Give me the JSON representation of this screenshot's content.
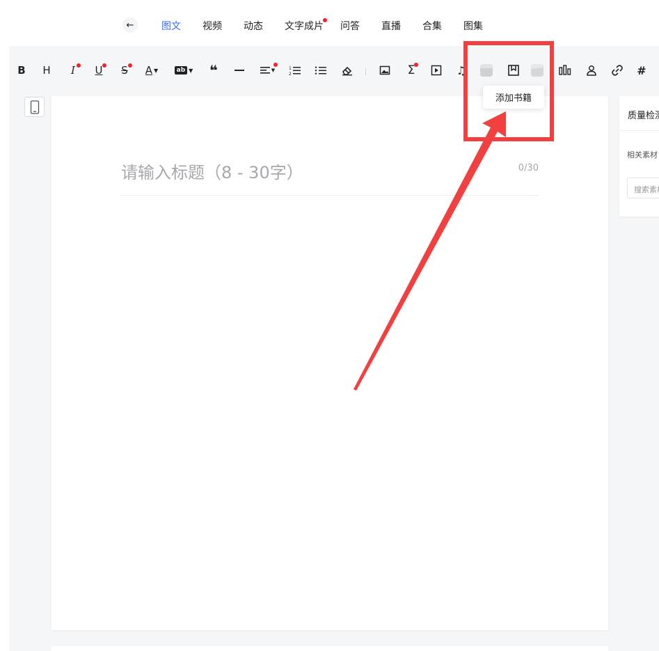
{
  "nav": {
    "back_icon": "arrow-left-icon",
    "tabs": [
      {
        "label": "图文",
        "active": true
      },
      {
        "label": "视频"
      },
      {
        "label": "动态"
      },
      {
        "label": "文字成片",
        "dot": true
      },
      {
        "label": "问答"
      },
      {
        "label": "直播"
      },
      {
        "label": "合集"
      },
      {
        "label": "图集"
      }
    ]
  },
  "toolbar": {
    "items": [
      "bold",
      "heading",
      "italic",
      "underline",
      "strikethrough",
      "font-color",
      "highlight",
      "quote",
      "divider",
      "align",
      "ordered-list",
      "unordered-list",
      "clear-format",
      "image",
      "formula",
      "video",
      "audio",
      "ad-block",
      "add-book",
      "vote",
      "chart",
      "user-card",
      "link",
      "hashtag"
    ],
    "glyphs": {
      "bold": "B",
      "heading": "H",
      "italic": "I",
      "underline": "U",
      "strikethrough": "S",
      "font_color": "A",
      "highlight": "ab",
      "quote": "❝",
      "hashtag": "#"
    },
    "accent_dot_color": "#f5222d"
  },
  "tooltip": {
    "text": "添加书籍"
  },
  "editor": {
    "title_placeholder": "请输入标题（8 - 30字）",
    "title_count": "0/30"
  },
  "right_panel": {
    "title": "质量检测",
    "label": "相关素材",
    "search_placeholder": "搜索素材"
  },
  "annotation": {
    "color": "#f24040"
  },
  "colors": {
    "accent": "#3b6cf6",
    "workspace_bg": "#f5f6f8"
  }
}
